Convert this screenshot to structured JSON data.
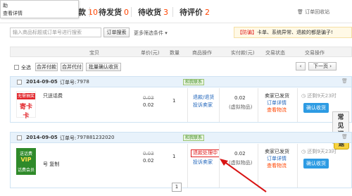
{
  "popup": {
    "line1": "助",
    "line2": "查看详情"
  },
  "tabs": [
    {
      "label": "付款",
      "count": "10"
    },
    {
      "label": "待发货",
      "count": "0"
    },
    {
      "label": "待收货",
      "count": "3"
    },
    {
      "label": "待评价",
      "count": "2"
    }
  ],
  "recycle_label": "订单回收站",
  "search": {
    "placeholder": "输入商品标题或订单号进行搜索",
    "button": "订单搜索",
    "more": "更多筛选条件"
  },
  "notice": {
    "tag": "【防骗】",
    "text": "卡单、系统异常、退款的都是骗子!"
  },
  "columns": [
    "宝贝",
    "单价(元)",
    "数量",
    "商品操作",
    "实付款(元)",
    "交易状态",
    "交易操作"
  ],
  "toolbar": {
    "select_all": "全选",
    "merge_ship": "合并付款",
    "merge_pay": "合并代付",
    "batch_confirm": "批量确认收货",
    "next_page": "下一页"
  },
  "orders": [
    {
      "date": "2014-09-05",
      "order_label": "订单号:",
      "order_no": "7978",
      "contact": "和我联系",
      "thumb_text": [
        "无需抽奖",
        "寄卡卡"
      ],
      "item_title": "只送话费",
      "orig_price": "0.03",
      "price": "0.02",
      "qty": "1",
      "actions": [
        "退款/退货",
        "投诉卖家"
      ],
      "paid": "0.02",
      "paid_note": "(虚拟物品)",
      "status": [
        "卖家已发货",
        "订单详情",
        "查看物流"
      ],
      "countdown": "还剩9天23时",
      "confirm": "确认收货"
    },
    {
      "date": "2014-09-05",
      "order_label": "订单号:",
      "order_no": "797881232020",
      "contact": "和我联系",
      "thumb_text": [
        "送话费",
        "VIP",
        "话费会员"
      ],
      "item_title": "号 复制",
      "orig_price": "0.03",
      "price": "0.02",
      "qty": "1",
      "actions": [
        "退款处理中",
        "投诉卖家"
      ],
      "paid": "0.02",
      "paid_note": "(虚拟物品)",
      "status": [
        "卖家已发货",
        "订单详情",
        "查看物流"
      ],
      "countdown": "还剩9天23时",
      "confirm": "确认收货"
    }
  ],
  "page_number": "1",
  "side_widget": [
    "常",
    "见",
    "问",
    "题"
  ],
  "colors": {
    "accent": "#ff4400",
    "blue_button": "#2d9be3",
    "highlight": "#e02020"
  }
}
